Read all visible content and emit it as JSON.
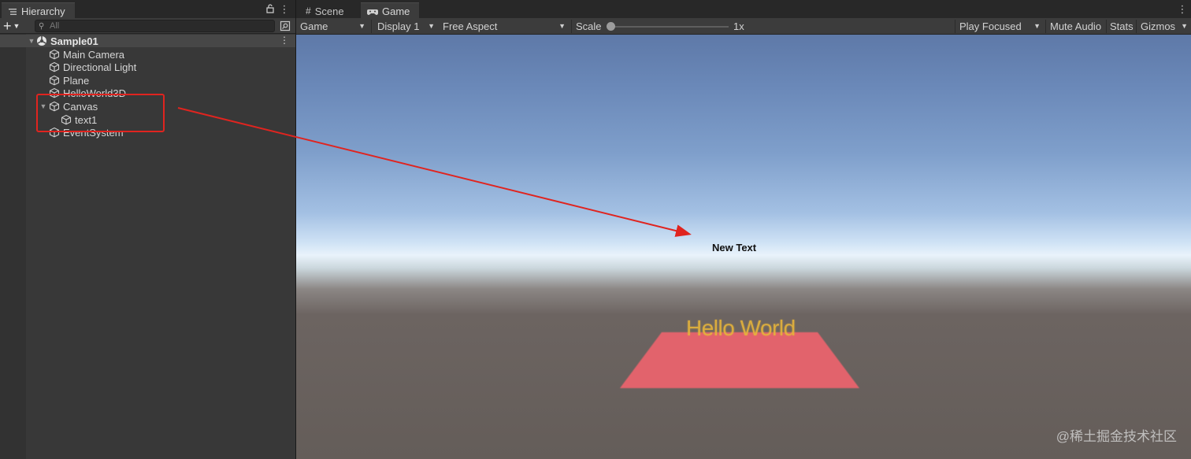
{
  "hierarchy": {
    "tab_label": "Hierarchy",
    "search_placeholder": "All",
    "scene": {
      "name": "Sample01"
    },
    "items": [
      {
        "label": "Main Camera"
      },
      {
        "label": "Directional Light"
      },
      {
        "label": "Plane"
      },
      {
        "label": "HelloWorld3D"
      },
      {
        "label": "Canvas"
      },
      {
        "label": "text1"
      },
      {
        "label": "EventSystem"
      }
    ]
  },
  "tabs": {
    "scene_label": "Scene",
    "game_label": "Game"
  },
  "game_toolbar": {
    "mode": "Game",
    "display": "Display 1",
    "aspect": "Free Aspect",
    "scale_label": "Scale",
    "scale_value": "1x",
    "scale_level": 0,
    "play_mode": "Play Focused",
    "mute_audio": "Mute Audio",
    "stats": "Stats",
    "gizmos": "Gizmos"
  },
  "viewport": {
    "ui_text": "New Text",
    "world_text": "Hello World"
  },
  "annotation": {
    "color": "#e0241f"
  },
  "watermark": "@稀土掘金技术社区",
  "colors": {
    "plane": "#e2646c",
    "hello_text": "#e6b43b"
  }
}
